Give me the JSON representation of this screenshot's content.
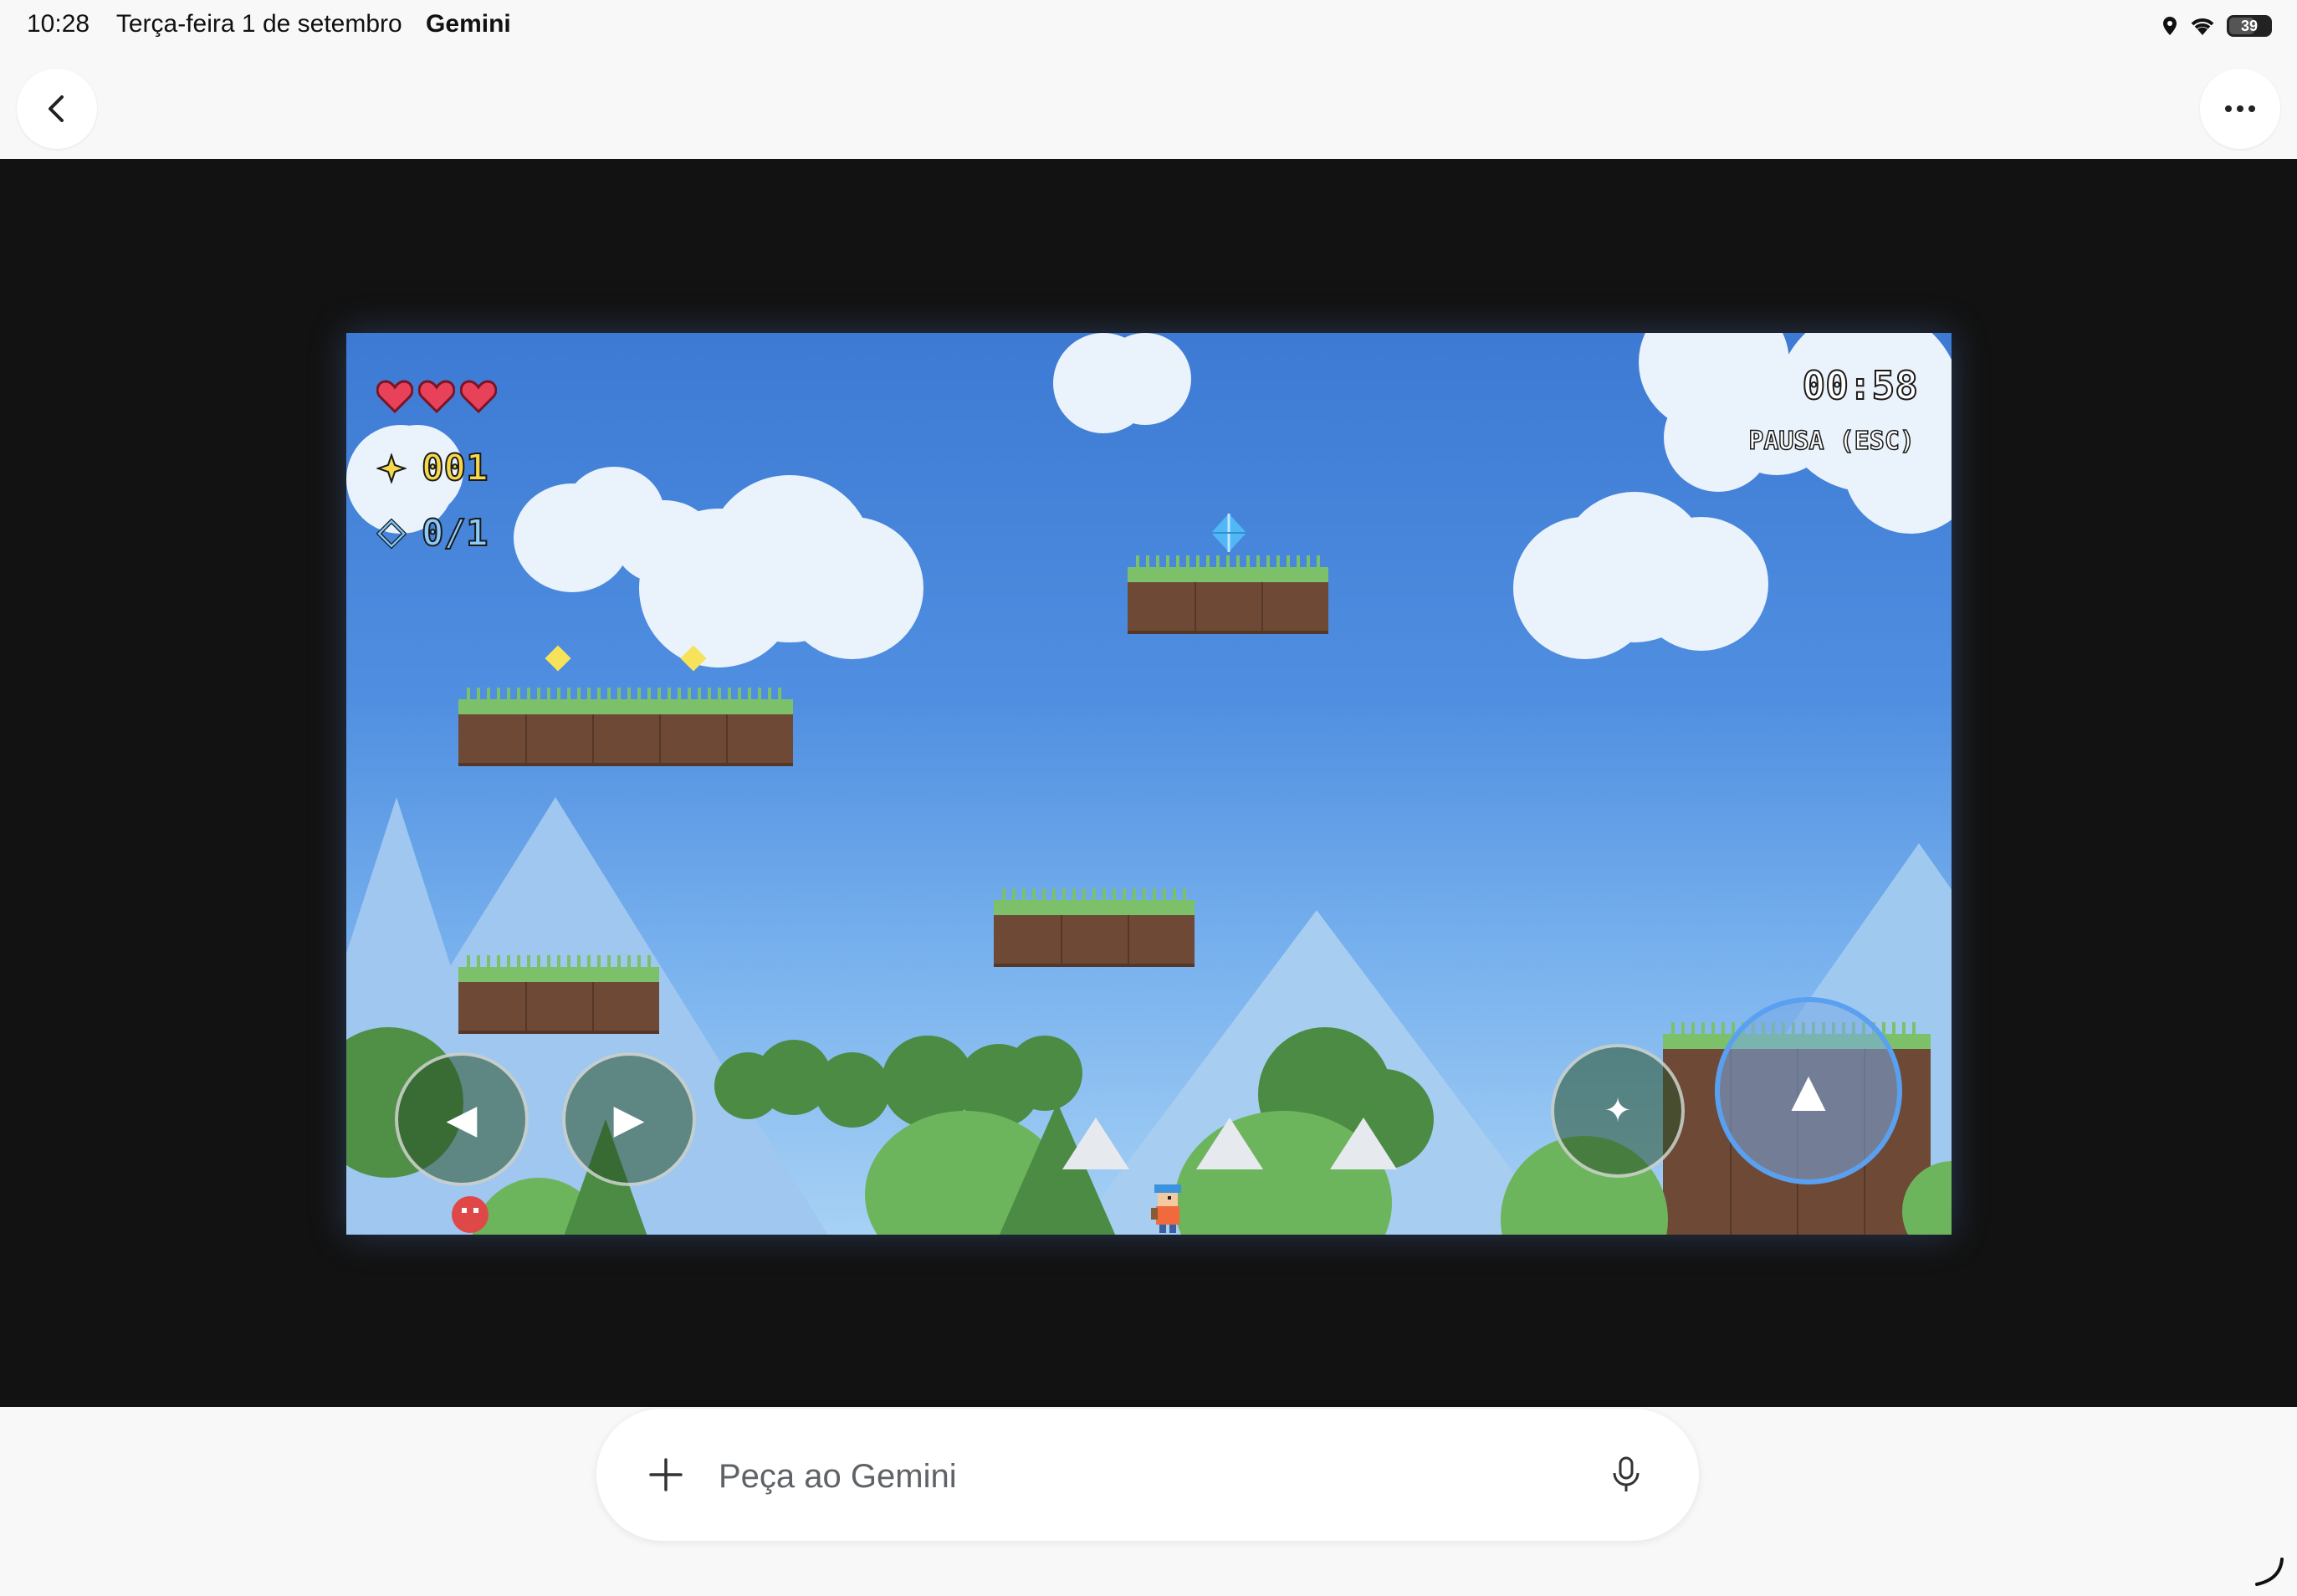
{
  "status_bar": {
    "time": "10:28",
    "date": "Terça-feira 1 de setembro",
    "app_name": "Gemini",
    "battery": "39",
    "icons": [
      "location-icon",
      "wifi-icon",
      "battery-icon"
    ]
  },
  "nav": {
    "back_icon": "chevron-left-icon",
    "more_icon": "more-horizontal-icon"
  },
  "game": {
    "hearts": 3,
    "coins": "001",
    "gems": "0/1",
    "timer": "00:58",
    "pause_label": "PAUSA (ESC)",
    "controls": {
      "left": "◀",
      "right": "▶",
      "action": "✦",
      "jump": "▲"
    },
    "colors": {
      "sky_top": "#3d7ad4",
      "grass": "#7cc16a",
      "dirt": "#6e4a36",
      "coin": "#f6e35a",
      "gem": "#52b7f5",
      "heart": "#e8415a"
    }
  },
  "chat": {
    "placeholder": "Peça ao Gemini",
    "plus_icon": "plus-icon",
    "mic_icon": "microphone-icon"
  }
}
